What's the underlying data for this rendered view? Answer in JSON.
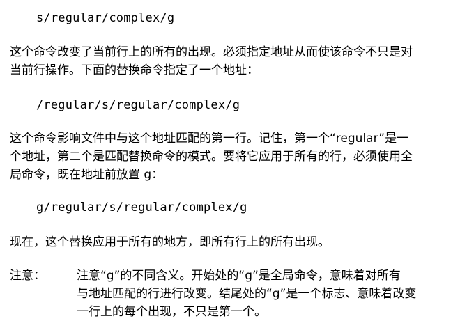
{
  "code_1": "s/regular/complex/g",
  "para_1": [
    "这个命令改变了当前行上的所有的出现。必须指定地址从而使该命令不只是对",
    "当前行操作。下面的替换命令指定了一个地址："
  ],
  "code_2": "/regular/s/regular/complex/g",
  "para_2": [
    "这个命令影响文件中与这个地址匹配的第一行。记住，第一个“regular”是一",
    "个地址，第二个是匹配替换命令的模式。要将它应用于所有的行，必须使用全",
    "局命令，既在地址前放置 g："
  ],
  "code_3": "g/regular/s/regular/complex/g",
  "para_3": [
    "现在，这个替换应用于所有的地方，即所有行上的所有出现。"
  ],
  "note": {
    "label": "注意：",
    "lines": [
      "注意“g”的不同含义。开始处的“g”是全局命令，意味着对所有",
      "与地址匹配的行进行改变。结尾处的“g”是一个标志、意味着改变",
      "一行上的每个出现，不只是第一个。"
    ]
  }
}
